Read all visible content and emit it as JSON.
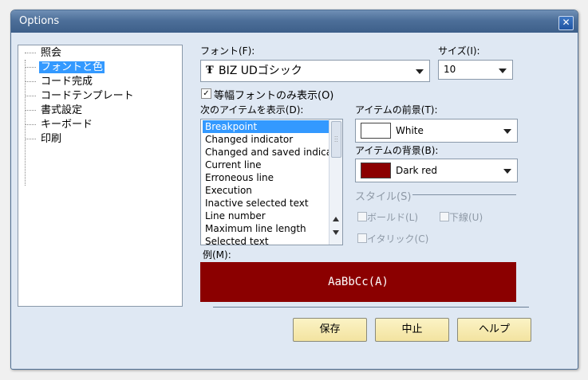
{
  "window": {
    "title": "Options",
    "close_label": "✕"
  },
  "tree": {
    "items": [
      {
        "label": "照会",
        "selected": false
      },
      {
        "label": "フォントと色",
        "selected": true
      },
      {
        "label": "コード完成",
        "selected": false
      },
      {
        "label": "コードテンプレート",
        "selected": false
      },
      {
        "label": "書式設定",
        "selected": false
      },
      {
        "label": "キーボード",
        "selected": false
      },
      {
        "label": "印刷",
        "selected": false
      }
    ]
  },
  "font": {
    "label": "フォント(F):",
    "value": "BIZ UDゴシック",
    "icon": "truetype-icon",
    "icon_glyph": "Ŧ"
  },
  "size": {
    "label": "サイズ(I):",
    "value": "10"
  },
  "monospace_only": {
    "label": "等幅フォントのみ表示(O)",
    "checked": true
  },
  "items_list": {
    "label": "次のアイテムを表示(D):",
    "items": [
      "Breakpoint",
      "Changed indicator",
      "Changed and saved indicat",
      "Current line",
      "Erroneous line",
      "Execution",
      "Inactive selected text",
      "Line number",
      "Maximum line length",
      "Selected text"
    ],
    "selected_index": 0
  },
  "foreground": {
    "label": "アイテムの前景(T):",
    "value": "White",
    "color": "#ffffff"
  },
  "background": {
    "label": "アイテムの背景(B):",
    "value": "Dark red",
    "color": "#8b0000"
  },
  "style": {
    "label": "スタイル(S)",
    "bold": "ボールド(L)",
    "underline": "下線(U)",
    "italic": "イタリック(C)"
  },
  "sample": {
    "label": "例(M):",
    "text": "AaBbCc(A)",
    "color": "#8b0000"
  },
  "buttons": {
    "save": "保存",
    "cancel": "中止",
    "help": "ヘルプ"
  }
}
